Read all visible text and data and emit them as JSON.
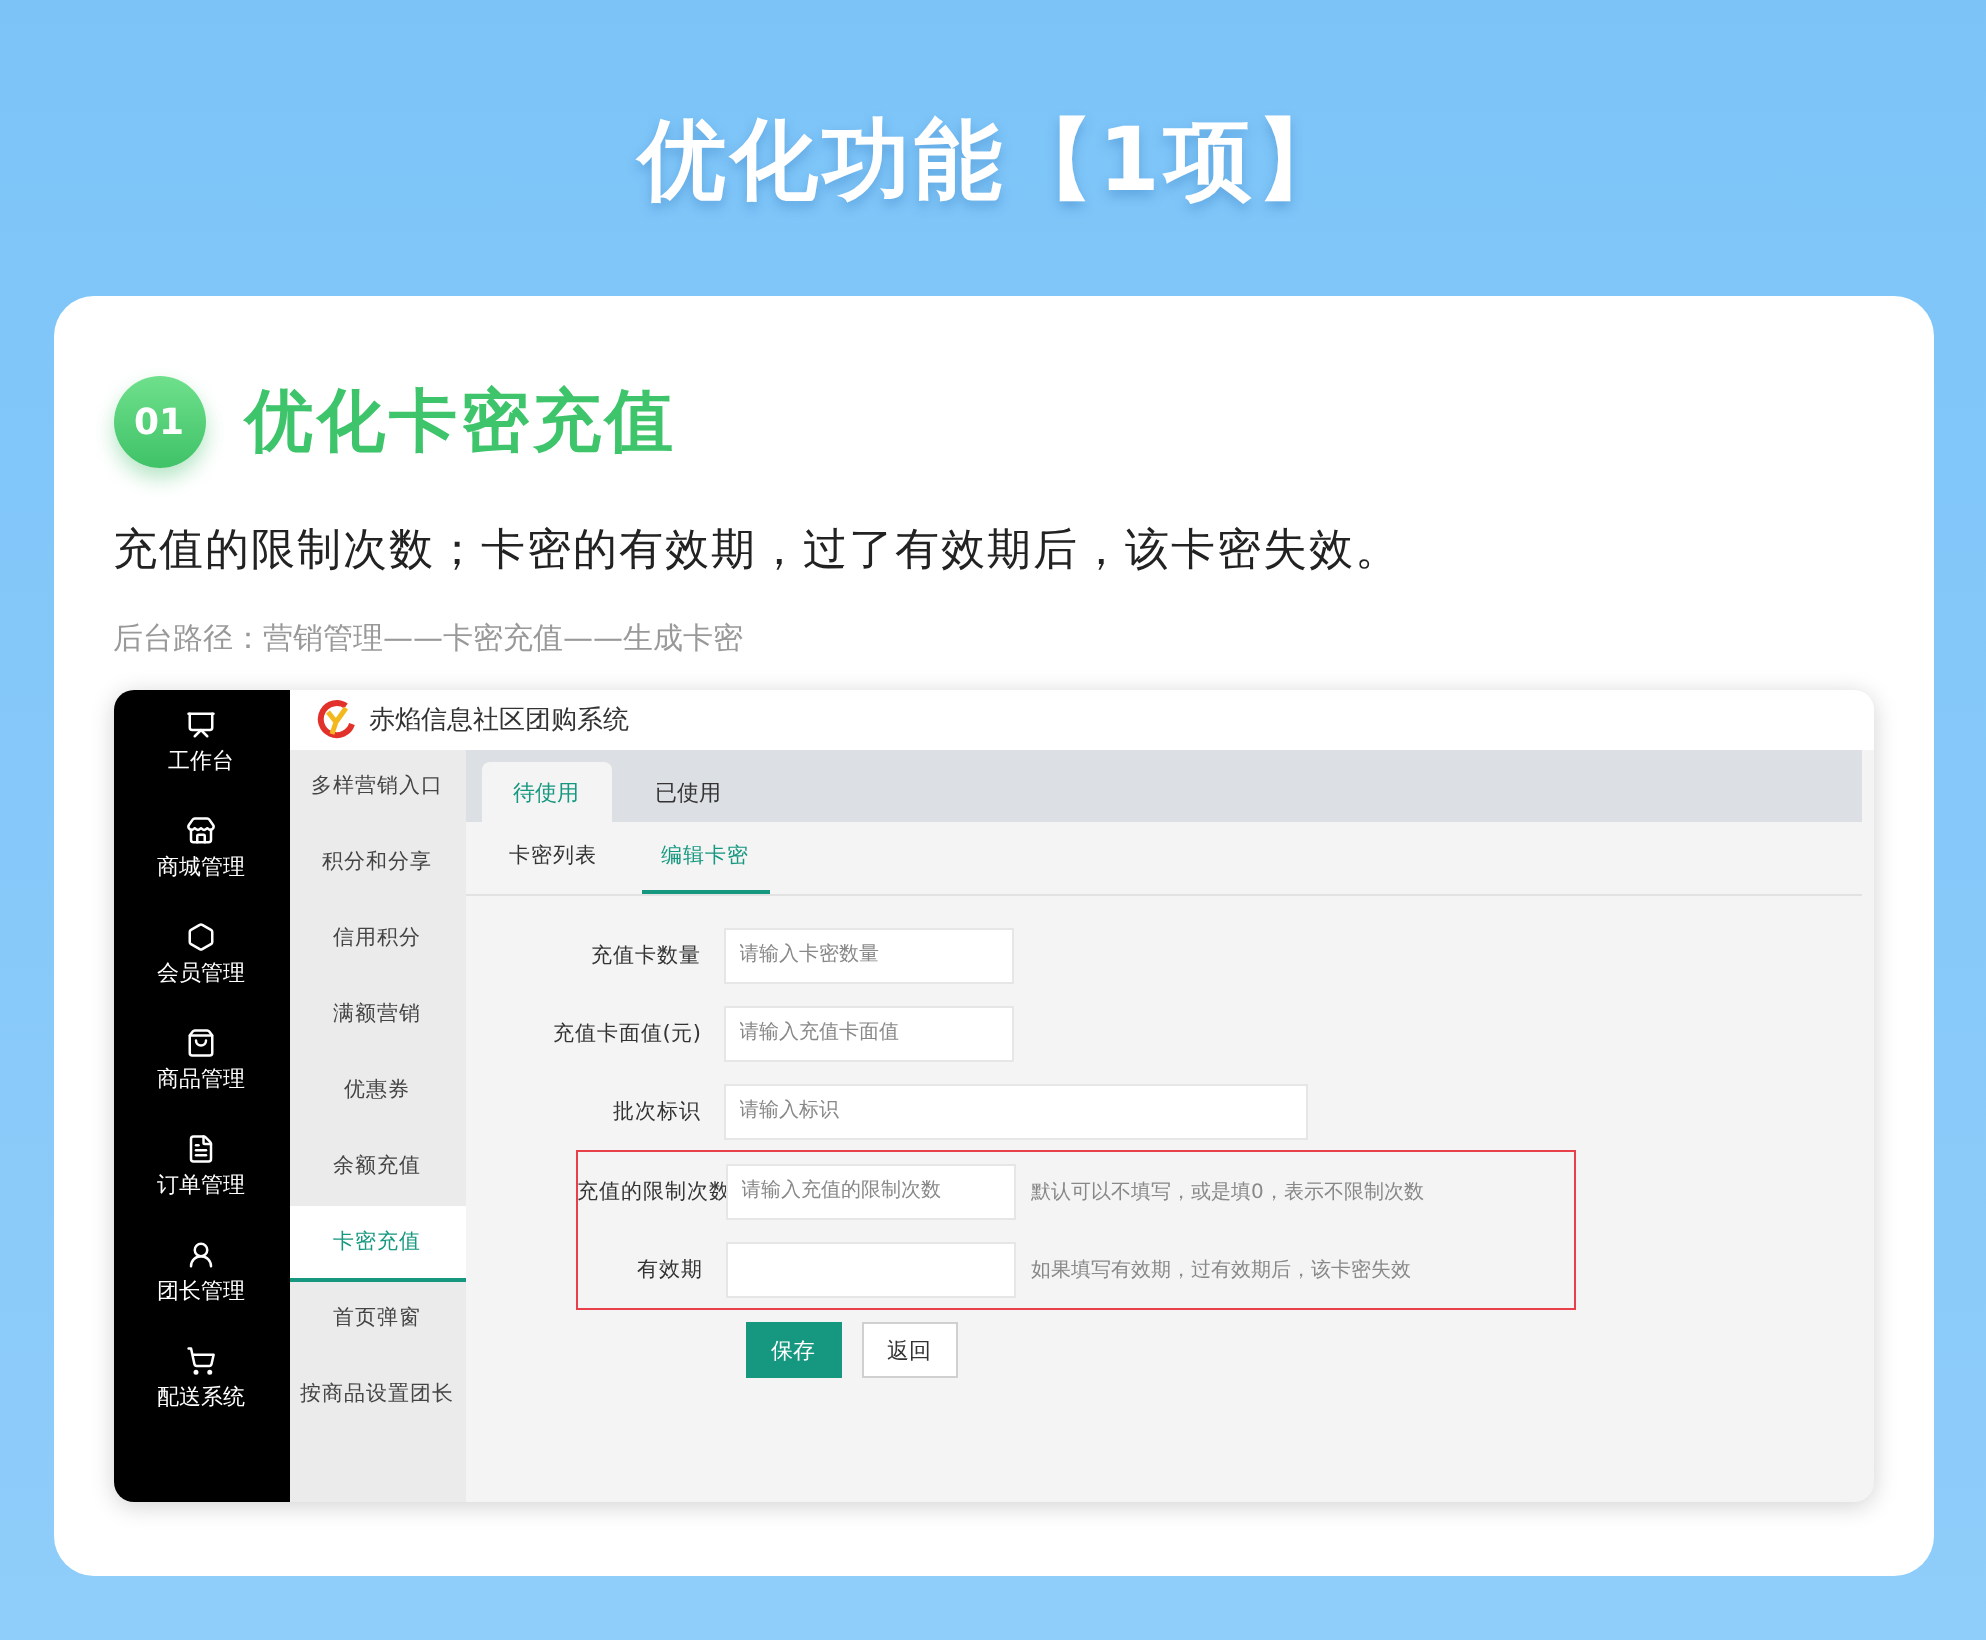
{
  "title": "优化功能【1项】",
  "card": {
    "badge": "01",
    "heading": "优化卡密充值",
    "description": "充值的限制次数；卡密的有效期，过了有效期后，该卡密失效。",
    "path": "后台路径：营销管理——卡密充值——生成卡密"
  },
  "app": {
    "header_title": "赤焰信息社区团购系统",
    "sidebar": [
      {
        "label": "工作台"
      },
      {
        "label": "商城管理"
      },
      {
        "label": "会员管理"
      },
      {
        "label": "商品管理"
      },
      {
        "label": "订单管理"
      },
      {
        "label": "团长管理"
      },
      {
        "label": "配送系统"
      }
    ],
    "subnav": [
      {
        "label": "多样营销入口",
        "selected": false
      },
      {
        "label": "积分和分享",
        "selected": false
      },
      {
        "label": "信用积分",
        "selected": false
      },
      {
        "label": "满额营销",
        "selected": false
      },
      {
        "label": "优惠券",
        "selected": false
      },
      {
        "label": "余额充值",
        "selected": false
      },
      {
        "label": "卡密充值",
        "selected": true
      },
      {
        "label": "首页弹窗",
        "selected": false
      },
      {
        "label": "按商品设置团长",
        "selected": false
      }
    ],
    "tabs": [
      {
        "label": "待使用",
        "selected": true
      },
      {
        "label": "已使用",
        "selected": false
      }
    ],
    "subtabs": [
      {
        "label": "卡密列表",
        "selected": false
      },
      {
        "label": "编辑卡密",
        "selected": true
      }
    ],
    "form": {
      "rows": [
        {
          "label": "充值卡数量",
          "placeholder": "请输入卡密数量",
          "wide": false,
          "highlighted": false
        },
        {
          "label": "充值卡面值(元)",
          "placeholder": "请输入充值卡面值",
          "wide": false,
          "highlighted": false
        },
        {
          "label": "批次标识",
          "placeholder": "请输入标识",
          "wide": true,
          "highlighted": false
        },
        {
          "label": "充值的限制次数",
          "placeholder": "请输入充值的限制次数",
          "hint": "默认可以不填写，或是填0，表示不限制次数",
          "wide": false,
          "highlighted": true
        },
        {
          "label": "有效期",
          "hint": "如果填写有效期，过有效期后，该卡密失效",
          "wide": false,
          "highlighted": true
        }
      ],
      "buttons": [
        {
          "label": "保存",
          "kind": "primary"
        },
        {
          "label": "返回",
          "kind": "default"
        }
      ]
    }
  }
}
